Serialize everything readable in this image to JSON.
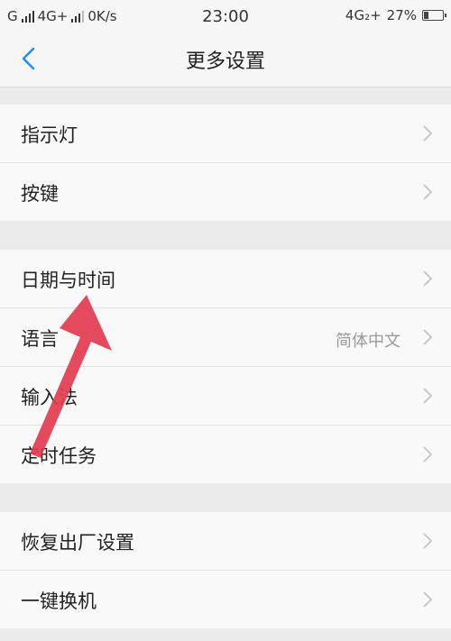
{
  "status_bar": {
    "carrier_left": "G",
    "network_left": "4G+",
    "speed": "0K/s",
    "time": "23:00",
    "network_right": "4G₂+",
    "battery_text": "27%",
    "battery_level": 0.27
  },
  "header": {
    "title": "更多设置",
    "back_icon": "chevron-left-icon",
    "accent_color": "#1a8cff"
  },
  "groups": [
    {
      "items": [
        {
          "label": "指示灯"
        },
        {
          "label": "按键"
        }
      ]
    },
    {
      "items": [
        {
          "label": "日期与时间"
        },
        {
          "label": "语言",
          "value": "简体中文"
        },
        {
          "label": "输入法"
        },
        {
          "label": "定时任务"
        }
      ]
    },
    {
      "items": [
        {
          "label": "恢复出厂设置"
        },
        {
          "label": "一键换机"
        }
      ]
    }
  ],
  "annotation": {
    "type": "red-arrow",
    "color": "#e23a4f"
  }
}
